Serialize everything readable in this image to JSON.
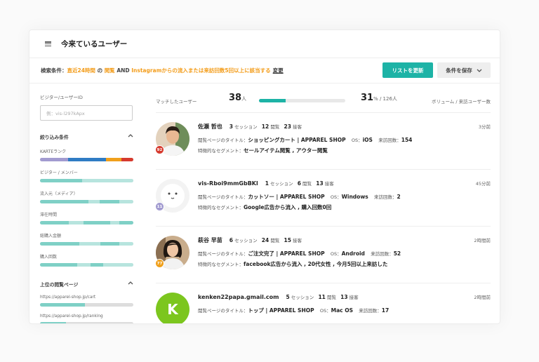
{
  "header": {
    "title": "今来ているユーザー"
  },
  "conditions": {
    "prefix": "検索条件：",
    "period": "直近24時間",
    "no": "の",
    "page": "閲覧",
    "and": "AND",
    "rule": "Instagramからの流入または来訪回数5回以上に該当する",
    "change": "変更",
    "update_button": "リストを更新",
    "save_button": "条件を保存"
  },
  "sidebar": {
    "visitor_label": "ビジター/ユーザーID",
    "visitor_placeholder": "例：vis-l297kApx",
    "filter_title": "絞り込み条件",
    "filters": [
      {
        "label": "KARTEランク",
        "segments": [
          {
            "color": "#a29bd0",
            "share": 0.3
          },
          {
            "color": "#2f7cc4",
            "share": 0.41
          },
          {
            "color": "#f0a01c",
            "share": 0.16
          },
          {
            "color": "#d63a2e",
            "share": 0.13
          }
        ]
      },
      {
        "label": "ビジター / メンバー",
        "segments": [
          {
            "color": "#7fd0c6",
            "share": 0.45
          },
          {
            "color": "#b7e4de",
            "share": 0.55
          }
        ]
      },
      {
        "label": "流入元（メディア）",
        "segments": [
          {
            "color": "#7fd0c6",
            "share": 0.52
          },
          {
            "color": "#b7e4de",
            "share": 0.12
          },
          {
            "color": "#7fd0c6",
            "share": 0.21
          },
          {
            "color": "#b7e4de",
            "share": 0.15
          }
        ]
      },
      {
        "label": "滞在時間",
        "segments": [
          {
            "color": "#7fd0c6",
            "share": 0.31
          },
          {
            "color": "#b7e4de",
            "share": 0.16
          },
          {
            "color": "#7fd0c6",
            "share": 0.28
          },
          {
            "color": "#b7e4de",
            "share": 0.1
          },
          {
            "color": "#7fd0c6",
            "share": 0.15
          }
        ]
      },
      {
        "label": "総購入金額",
        "segments": [
          {
            "color": "#7fd0c6",
            "share": 0.42
          },
          {
            "color": "#b7e4de",
            "share": 0.23
          },
          {
            "color": "#7fd0c6",
            "share": 0.2
          },
          {
            "color": "#b7e4de",
            "share": 0.15
          }
        ]
      },
      {
        "label": "購入回数",
        "segments": [
          {
            "color": "#7fd0c6",
            "share": 0.4
          },
          {
            "color": "#b7e4de",
            "share": 0.14
          },
          {
            "color": "#7fd0c6",
            "share": 0.14
          },
          {
            "color": "#b7e4de",
            "share": 0.32
          }
        ]
      }
    ],
    "pages_title": "上位の閲覧ページ",
    "pages": [
      {
        "url": "https://apparel-shop.jp/cart",
        "share": 0.48
      },
      {
        "url": "https://apparel-shop.jp/ranking",
        "share": 0.28
      }
    ]
  },
  "stats": {
    "matched_label": "マッチしたユーザー",
    "matched": "38",
    "matched_unit": "人",
    "share": 0.31,
    "percent": "31",
    "percent_total": "% / 126人",
    "volume_label": "ボリューム / 来訪ユーザー数"
  },
  "users": [
    {
      "name": "佐瀬 哲也",
      "sessions": "3",
      "views": "12",
      "contacts": "23",
      "time": "3分前",
      "page_title": "ショッピングカート | APPAREL SHOP",
      "os": "iOS",
      "visits": "154",
      "segment": "セールアイテム閲覧 , アウター閲覧",
      "rank": "92",
      "rank_color": "#d63a2e",
      "avatar": "photo-man"
    },
    {
      "name": "vis-Rboi9mmGbBKl",
      "sessions": "1",
      "views": "6",
      "contacts": "13",
      "time": "45分前",
      "page_title": "カットソー | APPAREL SHOP",
      "os": "Windows",
      "visits": "2",
      "segment": "Google広告から流入 , 購入回数0回",
      "rank": "11",
      "rank_color": "#a29bd0",
      "avatar": "visitor-face"
    },
    {
      "name": "萩谷 早苗",
      "sessions": "6",
      "views": "24",
      "contacts": "15",
      "time": "2時間前",
      "page_title": "ご注文完了 | APPAREL SHOP",
      "os": "Android",
      "visits": "52",
      "segment": "facebook広告から流入 , 20代女性 , 今月5回以上来訪した",
      "rank": "77",
      "rank_color": "#f0a01c",
      "avatar": "photo-woman"
    },
    {
      "name": "kenken22papa.gmail.com",
      "sessions": "5",
      "views": "11",
      "contacts": "13",
      "time": "2時間前",
      "page_title": "トップ | APPAREL SHOP",
      "os": "Mac OS",
      "visits": "17",
      "segment": "",
      "rank": "",
      "rank_color": "",
      "avatar": "K"
    }
  ],
  "labels": {
    "session": "セッション",
    "view": "閲覧",
    "contact": "接客",
    "page_title": "閲覧ページのタイトル：",
    "os": "OS：",
    "visits": "来訪回数：",
    "segment": "特徴的なセグメント："
  }
}
